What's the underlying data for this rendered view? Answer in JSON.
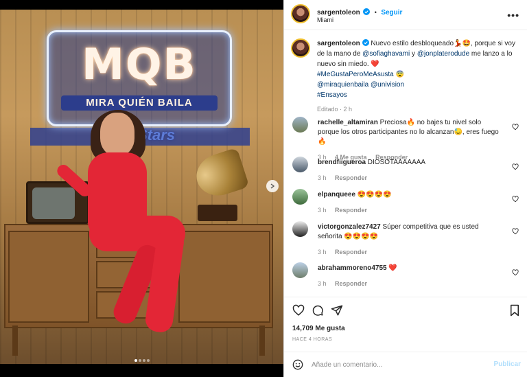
{
  "media": {
    "sign_big": "MQB",
    "sign_small": "MIRA QUIÉN BAILA",
    "sign_stars": "Stars",
    "dots": 4,
    "active_dot": 0
  },
  "header": {
    "username": "sargentoleon",
    "separator": "•",
    "follow_label": "Seguir",
    "location": "Miami",
    "more_icon": "more-horizontal-icon"
  },
  "caption": {
    "username": "sargentoleon",
    "text_1": "Nuevo estilo desbloqueado💃🤩, porque si voy de la mano de",
    "mention_1": "@sofiaghavami",
    "text_2": "y",
    "mention_2": "@jonplaterodude",
    "text_3": "me lanzo a lo nuevo sin miedo. ❤️",
    "hashtag_1": "#MeGustaPeroMeAsusta",
    "hashtag_1_emoji": "😨",
    "mention_3": "@miraquienbaila",
    "mention_4": "@univision",
    "hashtag_2": "#Ensayos",
    "edited": "Editado",
    "time": "2 h"
  },
  "comments": [
    {
      "username": "rachelle_altamiran",
      "text": "Preciosa🔥 no bajes tu nivel solo porque los otros participantes no lo alcanzan😓, eres fuego🔥",
      "time": "3 h",
      "likes": "4 Me gusta",
      "reply": "Responder"
    },
    {
      "username": "brendfiigueroa",
      "text": "DIOSOTAAAAAAA",
      "time": "3 h",
      "reply": "Responder"
    },
    {
      "username": "elpanqueee",
      "text": "😍😍😍😍",
      "time": "3 h",
      "reply": "Responder"
    },
    {
      "username": "victorgonzalez7427",
      "text": "Súper competitiva que es usted señorita 😍😍😍😍",
      "time": "3 h",
      "reply": "Responder"
    },
    {
      "username": "abrahammoreno4755",
      "text": "❤️",
      "time": "3 h",
      "reply": "Responder"
    }
  ],
  "actions": {
    "likes": "14,709 Me gusta",
    "ago": "HACE 4 HORAS"
  },
  "comment_box": {
    "placeholder": "Añade un comentario...",
    "publish": "Publicar"
  },
  "colors": {
    "accent": "#0095f6",
    "link": "#00376b",
    "muted": "#8e8e8e",
    "heart_red": "#ed4956"
  }
}
